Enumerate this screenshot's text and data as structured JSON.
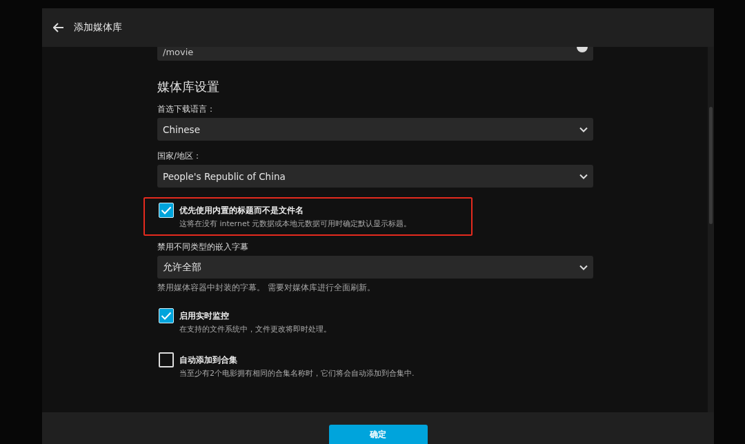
{
  "header": {
    "title": "添加媒体库"
  },
  "folder_field": {
    "value": "/movie"
  },
  "section": {
    "title": "媒体库设置"
  },
  "items": [
    {
      "kind": "select",
      "label": "首选下载语言：",
      "value": "Chinese"
    },
    {
      "kind": "select",
      "label": "国家/地区：",
      "value": "People's Republic of China"
    },
    {
      "kind": "checkbox",
      "label": "优先使用内置的标题而不是文件名",
      "description": "这将在没有 internet 元数据或本地元数据可用时确定默认显示标题。",
      "checked": true,
      "highlighted": true
    },
    {
      "kind": "select",
      "label": "禁用不同类型的嵌入字幕",
      "value": "允许全部",
      "help": "禁用媒体容器中封装的字幕。 需要对媒体库进行全面刷新。"
    },
    {
      "kind": "checkbox",
      "label": "启用实时监控",
      "description": "在支持的文件系统中，文件更改将即时处理。",
      "checked": true,
      "highlighted": false
    },
    {
      "kind": "checkbox",
      "label": "自动添加到合集",
      "description": "当至少有2个电影拥有相同的合集名称时，它们将会自动添加到合集中.",
      "checked": false,
      "highlighted": false
    }
  ],
  "footer": {
    "button": "确定"
  }
}
